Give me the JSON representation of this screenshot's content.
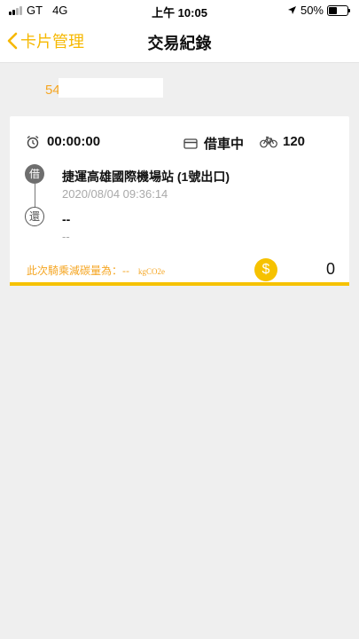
{
  "status_bar": {
    "carrier": "GT",
    "network": "4G",
    "time": "上午 10:05",
    "battery_percent": "50%",
    "battery_level": 0.5,
    "icons": [
      "signal-icon",
      "location-arrow-icon",
      "battery-icon"
    ]
  },
  "nav": {
    "back_label": "卡片管理",
    "title": "交易紀錄",
    "accent_color": "#f6b800"
  },
  "card": {
    "number_prefix": "54"
  },
  "record": {
    "duration": "00:00:00",
    "status": "借車中",
    "bike_id": "120",
    "borrow_badge": "借",
    "return_badge": "還",
    "borrow_station": "捷運高雄國際機場站 (1號出口)",
    "borrow_time": "2020/08/04 09:36:14",
    "return_station": "--",
    "return_time": "--",
    "carbon_label": "此次騎乘減碳量為：--",
    "carbon_unit": "kgCO2e",
    "coin_symbol": "$",
    "fare": "0",
    "icons": [
      "alarm-clock-icon",
      "card-icon",
      "bicycle-icon",
      "dollar-coin-icon"
    ]
  },
  "colors": {
    "accent": "#f6c200",
    "orange_text": "#f5a623",
    "background": "#efefef"
  }
}
